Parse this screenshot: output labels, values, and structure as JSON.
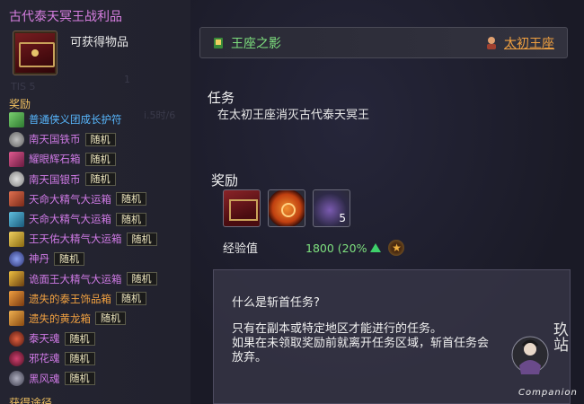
{
  "left_panel": {
    "title": "古代泰天冥王战利品",
    "obtain_label": "可获得物品",
    "reward_header": "奖励",
    "faded_text_1": "1",
    "faded_text_2": "TIS 5",
    "faded_text_3": "i.5时/6",
    "bottom_cut_label": "获得途径",
    "items": [
      {
        "label": "普通侠义团成长护符",
        "tag": "",
        "color": "blue",
        "icon": "green-charm-icon"
      },
      {
        "label": "南天国铁币",
        "tag": "随机",
        "color": "purple",
        "icon": "iron-coin-icon"
      },
      {
        "label": "耀眼辉石箱",
        "tag": "随机",
        "color": "purple",
        "icon": "gem-box-icon"
      },
      {
        "label": "南天国银币",
        "tag": "随机",
        "color": "purple",
        "icon": "silver-coin-icon"
      },
      {
        "label": "天命大精气大运箱",
        "tag": "随机",
        "color": "purple",
        "icon": "red-box-icon"
      },
      {
        "label": "天命大精气大运箱",
        "tag": "随机",
        "color": "purple",
        "icon": "blue-box-icon"
      },
      {
        "label": "王天佑大精气大运箱",
        "tag": "随机",
        "color": "purple",
        "icon": "gold-box-icon"
      },
      {
        "label": "神丹",
        "tag": "随机",
        "color": "purple",
        "icon": "pill-icon"
      },
      {
        "label": "诡面王大精气大运箱",
        "tag": "随机",
        "color": "purple",
        "icon": "mask-box-icon"
      },
      {
        "label": "遗失的泰王饰品箱",
        "tag": "随机",
        "color": "orange",
        "icon": "orange-box-icon"
      },
      {
        "label": "遗失的黄龙箱",
        "tag": "随机",
        "color": "orange",
        "icon": "dragon-box-icon"
      },
      {
        "label": "泰天魂",
        "tag": "随机",
        "color": "purple",
        "icon": "soul-icon"
      },
      {
        "label": "邪花魂",
        "tag": "随机",
        "color": "purple",
        "icon": "flower-soul-icon"
      },
      {
        "label": "黑风魂",
        "tag": "随机",
        "color": "purple",
        "icon": "wind-soul-icon"
      }
    ]
  },
  "quest_header": {
    "left_label": "王座之影",
    "right_label": "太初王座"
  },
  "task": {
    "heading": "任务",
    "description": "在太初王座消灭古代泰天冥王"
  },
  "rewards": {
    "heading": "奖励",
    "slots": [
      {
        "icon": "treasure-chest-icon",
        "count": ""
      },
      {
        "icon": "orange-coin-icon",
        "count": ""
      },
      {
        "icon": "soul-orb-icon",
        "count": "5"
      }
    ],
    "exp_label": "经验值",
    "exp_value": "1800 (20%"
  },
  "info": {
    "question": "什么是斩首任务?",
    "line1": "只有在副本或特定地区才能进行的任务。",
    "line2": "如果在未领取奖励前就离开任务区域，斩首任务会",
    "line3": "放弃。"
  },
  "watermark": {
    "label": "Companion",
    "cn": "玖站"
  },
  "colors": {
    "title_purple": "#d77fe0",
    "item_blue": "#58b8ff",
    "item_purple": "#d07ae6",
    "item_orange": "#f0a040",
    "header_green": "#7ee07e",
    "header_orange": "#f0a040"
  }
}
